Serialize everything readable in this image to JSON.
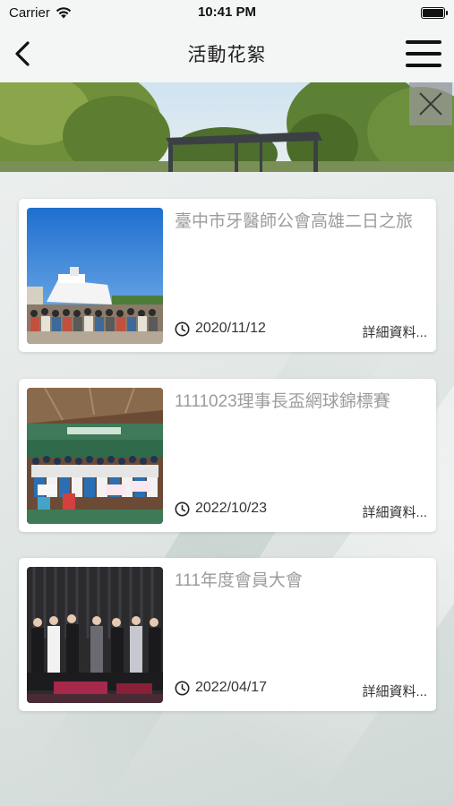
{
  "status": {
    "carrier": "Carrier",
    "time": "10:41 PM"
  },
  "nav": {
    "title": "活動花絮",
    "back_icon": "chevron-left-icon",
    "menu_icon": "hamburger-menu-icon"
  },
  "banner": {
    "close_icon": "close-icon"
  },
  "cards": [
    {
      "title": "臺中市牙醫師公會高雄二日之旅",
      "date": "2020/11/12",
      "more": "詳細資料..."
    },
    {
      "title": "1111023理事長盃網球錦標賽",
      "date": "2022/10/23",
      "more": "詳細資料..."
    },
    {
      "title": "111年度會員大會",
      "date": "2022/04/17",
      "more": "詳細資料..."
    }
  ],
  "colors": {
    "nav_background": "#f4f5f5",
    "card_title": "#9c9c9c",
    "card_background": "#ffffff"
  }
}
